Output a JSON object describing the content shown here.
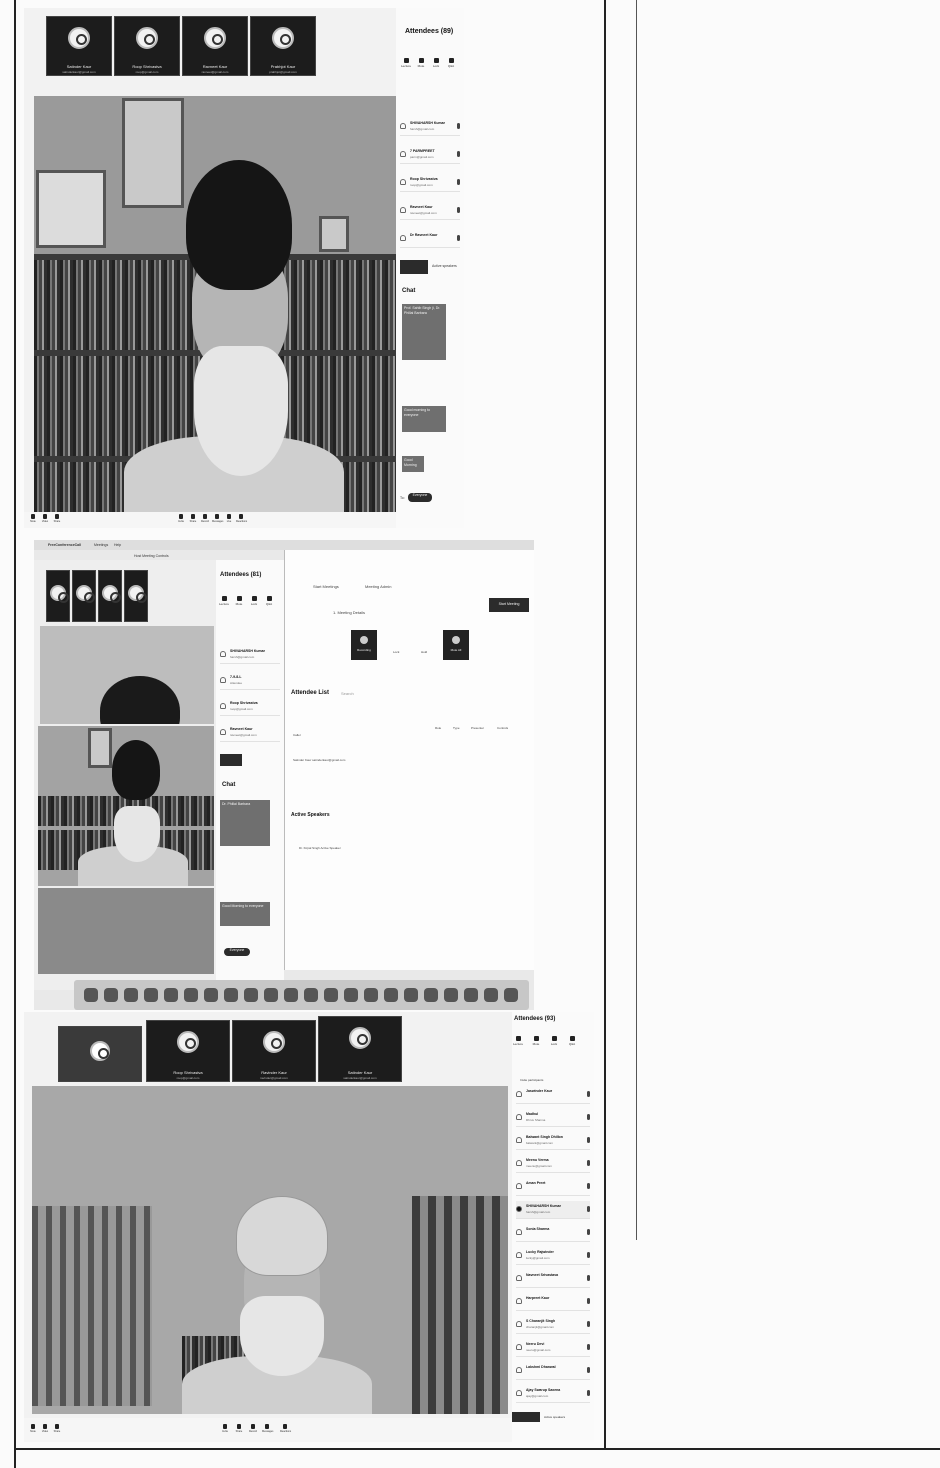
{
  "panel1": {
    "tiles": [
      {
        "name": "Satinder Kaur",
        "email": "satinderkaur@gmail.com"
      },
      {
        "name": "Roop Shrivastva",
        "email": "roop@gmail.com"
      },
      {
        "name": "Ravneet Kaur",
        "email": "ravneet@gmail.com"
      },
      {
        "name": "Prabhjot Kaur",
        "email": "prabhjot@gmail.com"
      }
    ],
    "attendees_title": "Attendees (89)",
    "controls": [
      "Lecture",
      "Mute",
      "Lock",
      "Q&A"
    ],
    "participants": [
      {
        "name": "SHIVAHARSH Kumar",
        "email": "harsh@gmail.com"
      },
      {
        "name": "7 PARMPREET",
        "email": "parm@gmail.com"
      },
      {
        "name": "Roop Shrivastva",
        "email": "roop@gmail.com"
      },
      {
        "name": "Ravneet Kaur",
        "email": "ravneet@gmail.com"
      },
      {
        "name": "Dr Ravneet Kaur",
        "email": ""
      }
    ],
    "active_speakers": "Active speakers",
    "chat_title": "Chat",
    "chat_msgs": [
      "Prof. Sahib Singh ji, Dr. Phillai Barbara",
      "Good morning to everyone",
      "Good Morning"
    ],
    "to_label": "To:",
    "to_value": "Everyone",
    "bottom_left": [
      "Mute",
      "Video",
      "Share"
    ],
    "bottom_mid": [
      "Invite",
      "Share",
      "Record",
      "Messages",
      "Live",
      "Reactions"
    ]
  },
  "panel2": {
    "app_title": "FreeConferenceCall",
    "menu": [
      "Meetings",
      "Help"
    ],
    "window_title": "Host Meeting Controls",
    "attendees_title": "Attendees (81)",
    "controls": [
      "Lecture",
      "Mute",
      "Lock",
      "Q&A"
    ],
    "participants": [
      {
        "name": "SHIVAHARSH Kumar",
        "email": "harsh@gmail.com"
      },
      {
        "name": "7-9-8-L",
        "email": "Attendee"
      },
      {
        "name": "Roop Shrivastva",
        "email": "roop@gmail.com"
      },
      {
        "name": "Ravneet Kaur",
        "email": "ravneet@gmail.com"
      }
    ],
    "chat_title": "Chat",
    "chat_msgs": [
      "Dr. Phillai Barbara",
      "Good Morning to everyone"
    ],
    "to_value": "Everyone",
    "web": {
      "nav": [
        "Start Meetings",
        "Meeting Admin"
      ],
      "meeting_label": "1. Meeting Details",
      "start_btn": "Start Meeting",
      "rec_buttons": [
        "Recording",
        "Lock",
        "Hold",
        "Mute All"
      ],
      "attendee_list": "Attendee List",
      "search": "Search",
      "col_heads": [
        "Role",
        "Type",
        "Presenter",
        "Controls"
      ],
      "caller": "Caller",
      "attendee_row": "Satinder Kaur   satinderkaur@gmail.com",
      "active_speakers": "Active Speakers",
      "speaker_row": "Dr. Kirpal Singh   Active Speaker"
    }
  },
  "panel3": {
    "tiles": [
      {
        "name": "",
        "email": ""
      },
      {
        "name": "Roop Shrivastva",
        "email": "roop@gmail.com"
      },
      {
        "name": "Ravinder Kaur",
        "email": "ravinder@gmail.com"
      },
      {
        "name": "Satinder Kaur",
        "email": "satinderkaur@gmail.com"
      }
    ],
    "attendees_title": "Attendees (93)",
    "controls": [
      "Lecture",
      "Mute",
      "Lock",
      "Q&A"
    ],
    "invite": "Invite participants",
    "participants": [
      {
        "name": "Jaswinder Kaur",
        "email": ""
      },
      {
        "name": "Madhul",
        "email": "Dhruv Sharma"
      },
      {
        "name": "Balwant Singh Dhillon",
        "email": "balwant@gmail.com"
      },
      {
        "name": "Meenu Verma",
        "email": "meenu@gmail.com"
      },
      {
        "name": "Aman Preet",
        "email": ""
      },
      {
        "name": "SHIVAHARSH Kumar",
        "email": "harsh@gmail.com"
      },
      {
        "name": "Sonia Sharma",
        "email": ""
      },
      {
        "name": "Lucky Rajwinder",
        "email": "lucky@gmail.com"
      },
      {
        "name": "Navneet Srivastava",
        "email": ""
      },
      {
        "name": "Harpreet Kaur",
        "email": ""
      },
      {
        "name": "S Charanjit Singh",
        "email": "charanjit@gmail.com"
      },
      {
        "name": "Neeru Devi",
        "email": "neeru@gmail.com"
      },
      {
        "name": "Lakshmi Dhanwal",
        "email": ""
      },
      {
        "name": "Ajay Swarup Saxena",
        "email": "ajay@gmail.com"
      }
    ],
    "active_speakers": "Active speakers",
    "bottom_left": [
      "Mute",
      "Video",
      "Share"
    ],
    "bottom_mid": [
      "Invite",
      "Share",
      "Record",
      "Messages",
      "Reactions"
    ]
  },
  "colors": {
    "sidebar_bg": "#fafafa",
    "tile_bg": "#1c1c1c",
    "dark_button": "#2b2b2b"
  }
}
